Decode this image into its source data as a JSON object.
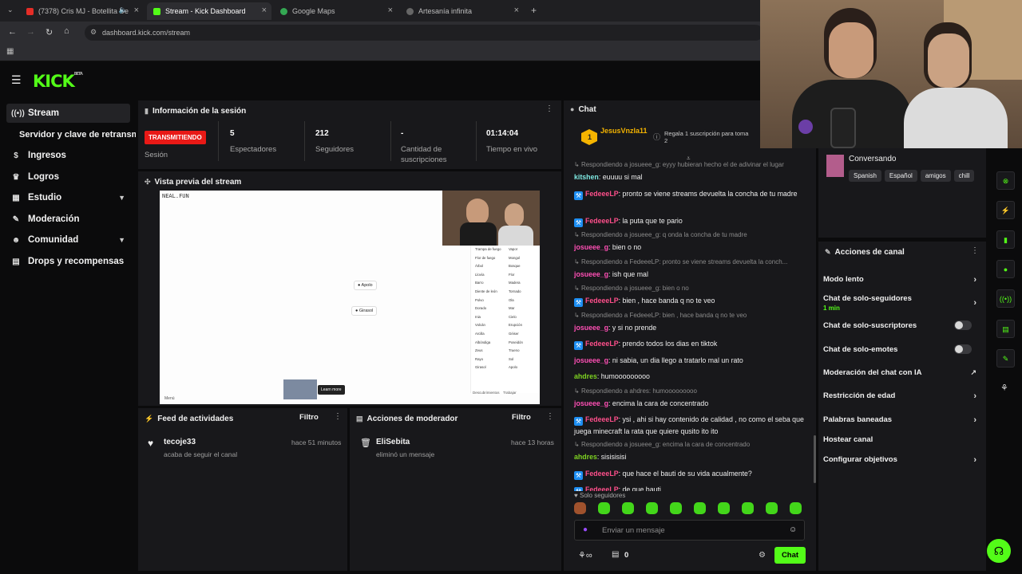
{
  "browser": {
    "tabs": [
      {
        "title": "(7378) Cris MJ - Botellita De",
        "active": false
      },
      {
        "title": "Stream - Kick Dashboard",
        "active": true
      },
      {
        "title": "Google Maps",
        "active": false
      },
      {
        "title": "Artesanía infinita",
        "active": false
      }
    ],
    "url": "dashboard.kick.com/stream"
  },
  "brand": {
    "logo": "KICK",
    "logo_sup": "BETA",
    "accent": "#53fc18"
  },
  "sidebar": {
    "items": [
      {
        "label": "Stream",
        "icon": "broadcast-icon"
      },
      {
        "label": "Servidor y clave de retransmisión",
        "icon": ""
      },
      {
        "label": "Ingresos",
        "icon": "dollar-icon"
      },
      {
        "label": "Logros",
        "icon": "trophy-icon"
      },
      {
        "label": "Estudio",
        "icon": "grid-icon"
      },
      {
        "label": "Moderación",
        "icon": "wrench-icon"
      },
      {
        "label": "Comunidad",
        "icon": "users-icon"
      },
      {
        "label": "Drops y recompensas",
        "icon": "gift-icon"
      }
    ]
  },
  "session": {
    "title": "Información de la sesión",
    "status": "TRANSMITIENDO",
    "status_label": "Sesión",
    "viewers": "5",
    "viewers_label": "Espectadores",
    "followers": "212",
    "followers_label": "Seguidores",
    "subs": "-",
    "subs_label": "Cantidad de suscripciones",
    "uptime": "01:14:04",
    "uptime_label": "Tiempo en vivo"
  },
  "preview": {
    "title": "Vista previa del stream",
    "game_brand": "NEAL.FUN",
    "items": [
      "Apolo",
      "Girasol"
    ],
    "list": [
      "Trampa de fuego",
      "Vapor",
      "Flor de fuego",
      "Mongol",
      "Árbol",
      "Bosque",
      "Llovía",
      "Flor",
      "Barro",
      "Madera",
      "Diente de león",
      "Tornado",
      "Polvo",
      "Ola",
      "Dorado",
      "Mar",
      "Inia",
      "Cielo",
      "Volcán",
      "Erupción",
      "Arcilla",
      "Géiser",
      "Albóndiga",
      "Poseidón",
      "Zeus",
      "Trueno",
      "Rayo",
      "Sol",
      "Girasol",
      "Apolo"
    ],
    "learn_more": "Learn more",
    "footer_left": "Menú",
    "footer_right1": "Descubrimientos",
    "footer_right2": "Trabajar"
  },
  "feed": {
    "title": "Feed de actividades",
    "filter": "Filtro",
    "items": [
      {
        "user": "tecoje33",
        "action": "acaba de seguir el canal",
        "time": "hace 51 minutos"
      }
    ]
  },
  "modactions": {
    "title": "Acciones de moderador",
    "filter": "Filtro",
    "items": [
      {
        "user": "EliSebita",
        "action": "eliminó un mensaje",
        "time": "hace 13 horas"
      }
    ]
  },
  "chat": {
    "title": "Chat",
    "pinned_user": "JesusVnzla11",
    "pinned_count": "1",
    "gift_text": "Regala 1 suscripción para toma",
    "gift_sub": "2",
    "messages": [
      {
        "type": "reply",
        "text": "Respondiendo a josueee_g: eyyy hubieran hecho el de adivinar el lugar"
      },
      {
        "type": "msg",
        "user": "kitshen",
        "cls": "u-kit",
        "badge": false,
        "text": "euuuu si mal"
      },
      {
        "type": "msg",
        "user": "FedeeeLP",
        "cls": "u-fed",
        "badge": true,
        "text": "pronto se viene streams devuelta la concha de tu madre"
      },
      {
        "type": "msg",
        "user": "FedeeeLP",
        "cls": "u-fed",
        "badge": true,
        "text": "la puta que te pario"
      },
      {
        "type": "reply",
        "text": "Respondiendo a josueee_g: q onda la concha de tu madre"
      },
      {
        "type": "msg",
        "user": "josueee_g",
        "cls": "u-jos",
        "badge": false,
        "text": "bien o no"
      },
      {
        "type": "reply",
        "text": "Respondiendo a FedeeeLP: pronto se viene streams devuelta la conch..."
      },
      {
        "type": "msg",
        "user": "josueee_g",
        "cls": "u-jos",
        "badge": false,
        "text": "ish que mal"
      },
      {
        "type": "reply",
        "text": "Respondiendo a josueee_g: bien o no"
      },
      {
        "type": "msg",
        "user": "FedeeeLP",
        "cls": "u-fed",
        "badge": true,
        "text": "bien , hace banda q no te veo"
      },
      {
        "type": "reply",
        "text": "Respondiendo a FedeeeLP: bien , hace banda q no te veo"
      },
      {
        "type": "msg",
        "user": "josueee_g",
        "cls": "u-jos",
        "badge": false,
        "text": "y si no prende"
      },
      {
        "type": "msg",
        "user": "FedeeeLP",
        "cls": "u-fed",
        "badge": true,
        "text": "prendo todos los dias en tiktok"
      },
      {
        "type": "msg",
        "user": "josueee_g",
        "cls": "u-jos",
        "badge": false,
        "text": "ni sabia, un dia llego a tratarlo mal un rato"
      },
      {
        "type": "msg",
        "user": "ahdres",
        "cls": "u-ahd",
        "badge": false,
        "text": "humooooooooo"
      },
      {
        "type": "reply",
        "text": "Respondiendo a ahdres: humooooooooo"
      },
      {
        "type": "msg",
        "user": "josueee_g",
        "cls": "u-jos",
        "badge": false,
        "text": "encima la cara de concentrado"
      },
      {
        "type": "msg",
        "user": "FedeeeLP",
        "cls": "u-fed",
        "badge": true,
        "text": "ysi , ahi si hay contenido de calidad , no como el seba que juega minecraft la rata que quiere qusito ito ito"
      },
      {
        "type": "reply",
        "text": "Respondiendo a josueee_g: encima la cara de concentrado"
      },
      {
        "type": "msg",
        "user": "ahdres",
        "cls": "u-ahd",
        "badge": false,
        "text": "sisisisisi"
      },
      {
        "type": "msg",
        "user": "FedeeeLP",
        "cls": "u-fed",
        "badge": true,
        "text": "que hace el bauti de su vida acualmente?"
      },
      {
        "type": "msg",
        "user": "FedeeeLP",
        "cls": "u-fed",
        "badge": true,
        "text": "de que bauti"
      }
    ],
    "followers_only": "Solo seguidores",
    "input_placeholder": "Enviar un mensaje",
    "points": "0",
    "send": "Chat"
  },
  "channel": {
    "category": "Conversando",
    "tags": [
      "Spanish",
      "Español",
      "amigos",
      "chill"
    ],
    "actions_title": "Acciones de canal",
    "actions": [
      {
        "label": "Modo lento",
        "kind": "chev"
      },
      {
        "label": "Chat de solo-seguidores",
        "sub": "1 min",
        "kind": "chev"
      },
      {
        "label": "Chat de solo-suscriptores",
        "kind": "toggle"
      },
      {
        "label": "Chat de solo-emotes",
        "kind": "toggle"
      },
      {
        "label": "Moderación del chat con IA",
        "kind": "ext"
      },
      {
        "label": "Restricción de edad",
        "kind": "chev"
      },
      {
        "label": "Palabras baneadas",
        "kind": "chev"
      },
      {
        "label": "Hostear canal",
        "kind": "none"
      },
      {
        "label": "Configurar objetivos",
        "kind": "chev"
      }
    ]
  }
}
